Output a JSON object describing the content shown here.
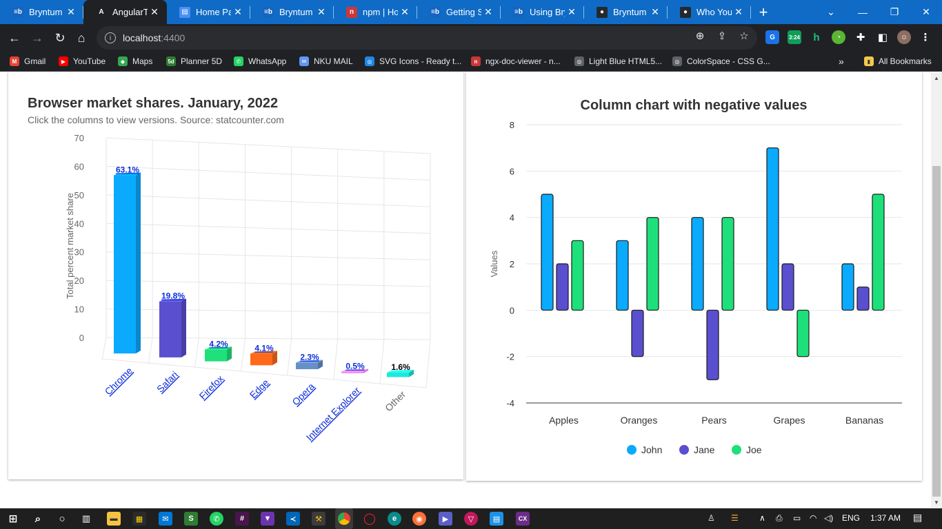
{
  "browser": {
    "tabs": [
      {
        "title": "Bryntum G",
        "favicon": "bryntum-icon",
        "fav_text": "≡b",
        "fav_color": "#1565c0",
        "active": false
      },
      {
        "title": "AngularTe",
        "favicon": "angular-icon",
        "fav_text": "A",
        "fav_color": "#202124",
        "active": true
      },
      {
        "title": "Home Pag",
        "favicon": "document-icon",
        "fav_text": "▤",
        "fav_color": "#4a8ff5",
        "active": false
      },
      {
        "title": "Bryntum G",
        "favicon": "bryntum-icon",
        "fav_text": "≡b",
        "fav_color": "#1565c0",
        "active": false
      },
      {
        "title": "npm | Hor",
        "favicon": "npm-icon",
        "fav_text": "n",
        "fav_color": "#cb3837",
        "active": false
      },
      {
        "title": "Getting St",
        "favicon": "bryntum-icon",
        "fav_text": "≡b",
        "fav_color": "#1565c0",
        "active": false
      },
      {
        "title": "Using Bryn",
        "favicon": "bryntum-icon",
        "fav_text": "≡b",
        "fav_color": "#1565c0",
        "active": false
      },
      {
        "title": "Bryntum",
        "favicon": "github-icon",
        "fav_text": "●",
        "fav_color": "#24292e",
        "active": false
      },
      {
        "title": "Who You'",
        "favicon": "github-icon",
        "fav_text": "●",
        "fav_color": "#24292e",
        "active": false
      }
    ],
    "new_tab_label": "+",
    "url_host": "localhost",
    "url_port": ":4400",
    "bookmarks": [
      {
        "label": "Gmail",
        "icon": "gmail-icon",
        "glyph": "M",
        "color": "#ea4335"
      },
      {
        "label": "YouTube",
        "icon": "youtube-icon",
        "glyph": "▶",
        "color": "#ff0000"
      },
      {
        "label": "Maps",
        "icon": "maps-icon",
        "glyph": "◆",
        "color": "#34a853"
      },
      {
        "label": "Planner 5D",
        "icon": "planner5d-icon",
        "glyph": "5d",
        "color": "#2e7d32"
      },
      {
        "label": "WhatsApp",
        "icon": "whatsapp-icon",
        "glyph": "✆",
        "color": "#25d366"
      },
      {
        "label": "NKU MAIL",
        "icon": "mail-icon",
        "glyph": "✉",
        "color": "#5e97f6"
      },
      {
        "label": "SVG Icons - Ready t...",
        "icon": "globe-icon",
        "glyph": "◎",
        "color": "#1e88e5"
      },
      {
        "label": "ngx-doc-viewer - n...",
        "icon": "npm-icon",
        "glyph": "n",
        "color": "#cb3837"
      },
      {
        "label": "Light Blue HTML5...",
        "icon": "globe-icon",
        "glyph": "◎",
        "color": "#5f6368"
      },
      {
        "label": "ColorSpace - CSS G...",
        "icon": "globe-icon",
        "glyph": "◎",
        "color": "#5f6368"
      }
    ],
    "bookmarks_overflow": "»",
    "all_bookmarks_label": "All Bookmarks",
    "badge_time": "3:24"
  },
  "chart_data": [
    {
      "type": "bar",
      "title": "Browser market shares. January, 2022",
      "subtitle": "Click the columns to view versions. Source: statcounter.com",
      "ylabel": "Total percent market share",
      "xlabel": "",
      "ylim": [
        0,
        70
      ],
      "yticks": [
        "0",
        "10",
        "20",
        "30",
        "40",
        "50",
        "60",
        "70"
      ],
      "categories": [
        "Chrome",
        "Safari",
        "Firefox",
        "Edge",
        "Opera",
        "Internet Explorer",
        "Other"
      ],
      "values": [
        63.1,
        19.8,
        4.2,
        4.1,
        2.3,
        0.5,
        1.6
      ],
      "data_labels": [
        "63.1%",
        "19.8%",
        "4.2%",
        "4.1%",
        "2.3%",
        "0.5%",
        "1.6%"
      ],
      "colors": [
        "#0aaaff",
        "#5a4fcf",
        "#1fe07a",
        "#ff6a1a",
        "#6790c8",
        "#ee82ee",
        "#1de9d8"
      ],
      "drilldown": [
        true,
        true,
        true,
        true,
        true,
        true,
        false
      ],
      "grid": true,
      "style": "3d"
    },
    {
      "type": "bar",
      "title": "Column chart with negative values",
      "ylabel": "Values",
      "xlabel": "",
      "ylim": [
        -4,
        8
      ],
      "yticks": [
        "-4",
        "-2",
        "0",
        "2",
        "4",
        "6",
        "8"
      ],
      "categories": [
        "Apples",
        "Oranges",
        "Pears",
        "Grapes",
        "Bananas"
      ],
      "series": [
        {
          "name": "John",
          "values": [
            5,
            3,
            4,
            7,
            2
          ],
          "color": "#0aaaff"
        },
        {
          "name": "Jane",
          "values": [
            2,
            -2,
            -3,
            2,
            1
          ],
          "color": "#5a4fcf"
        },
        {
          "name": "Joe",
          "values": [
            3,
            4,
            4,
            -2,
            5
          ],
          "color": "#1de07a"
        }
      ],
      "grid": true,
      "legend": "bottom"
    }
  ],
  "taskbar": {
    "time": "1:37 AM",
    "lang": "ENG"
  }
}
